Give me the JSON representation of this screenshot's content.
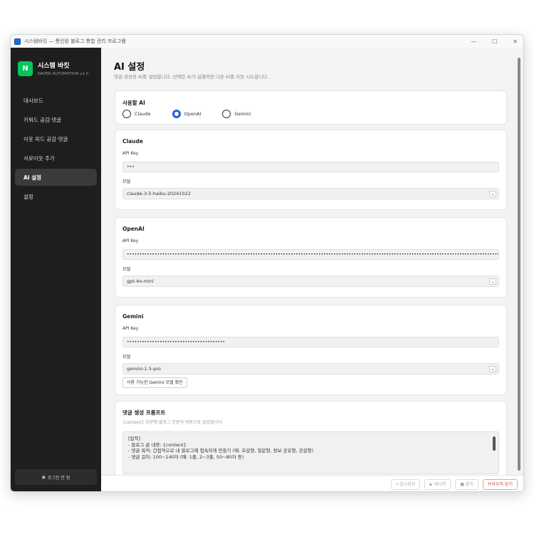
{
  "window": {
    "title": "시스템바킷 — 통인원 블로그 통합 관리 프로그램",
    "controls": {
      "minimize": "—",
      "maximize": "☐",
      "close": "✕"
    }
  },
  "sidebar": {
    "brand": {
      "logo": "N",
      "name": "시스템 바킷",
      "subtitle": "NAVER AUTOMATION v1.0"
    },
    "items": [
      {
        "label": "대시보드",
        "active": false
      },
      {
        "label": "키워드 공감·댓글",
        "active": false
      },
      {
        "label": "이웃 피드 공감·댓글",
        "active": false
      },
      {
        "label": "서로이웃 추가",
        "active": false
      },
      {
        "label": "AI 설정",
        "active": true
      },
      {
        "label": "설정",
        "active": false
      }
    ],
    "login_status": {
      "dot": "●",
      "label": "로그인 안 됨"
    }
  },
  "main": {
    "title": "AI 설정",
    "description": "댓글 생성용 AI를 설정합니다. 선택한 AI가 실패하면 다른 AI를 자동 시도합니다.",
    "provider_section": {
      "title": "사용할 AI",
      "options": [
        {
          "label": "Claude",
          "checked": false
        },
        {
          "label": "OpenAI",
          "checked": true
        },
        {
          "label": "Gemini",
          "checked": false
        }
      ]
    },
    "claude": {
      "title": "Claude",
      "api_key_label": "API Key",
      "api_key_value": "•••",
      "model_label": "모델",
      "model_value": "claude-3-5-haiku-20241022"
    },
    "openai": {
      "title": "OpenAI",
      "api_key_label": "API Key",
      "api_key_value": "••••••••••••••••••••••••••••••••••••••••••••••••••••••••••••••••••••••••••••••••••••••••••••••••••••••••••••••••••••••••••••••••••••••••••••••••••••••••••",
      "model_label": "모델",
      "model_value": "gpt-4o-mini"
    },
    "gemini": {
      "title": "Gemini",
      "api_key_label": "API Key",
      "api_key_value": "•••••••••••••••••••••••••••••••••••••••",
      "model_label": "모델",
      "model_value": "gemini-1.5-pro",
      "check_models_button": "사용 가능한 Gemini 모델 확인"
    },
    "prompt": {
      "title": "댓글 생성 프롬프트",
      "hint": "{content} 부분에 블로그 본문이 자동으로 삽입됩니다.",
      "lines": [
        "[입력]",
        "- 블로그 글 내용: {content}",
        "- 댓글 목적: 간접적으로 내 블로그에 접속하게 만들기 (예: 호감형, 질문형, 정보 공유형, 공감형)",
        "- 댓글 길이: 100~140자 (예: 1줄, 2~3줄, 50~80자 등)"
      ]
    }
  },
  "footer": {
    "pause": "⏸ 일시정지",
    "resume": "▶ 재시작",
    "stop": "■ 중지",
    "close_browser": "브라우저 닫기"
  }
}
